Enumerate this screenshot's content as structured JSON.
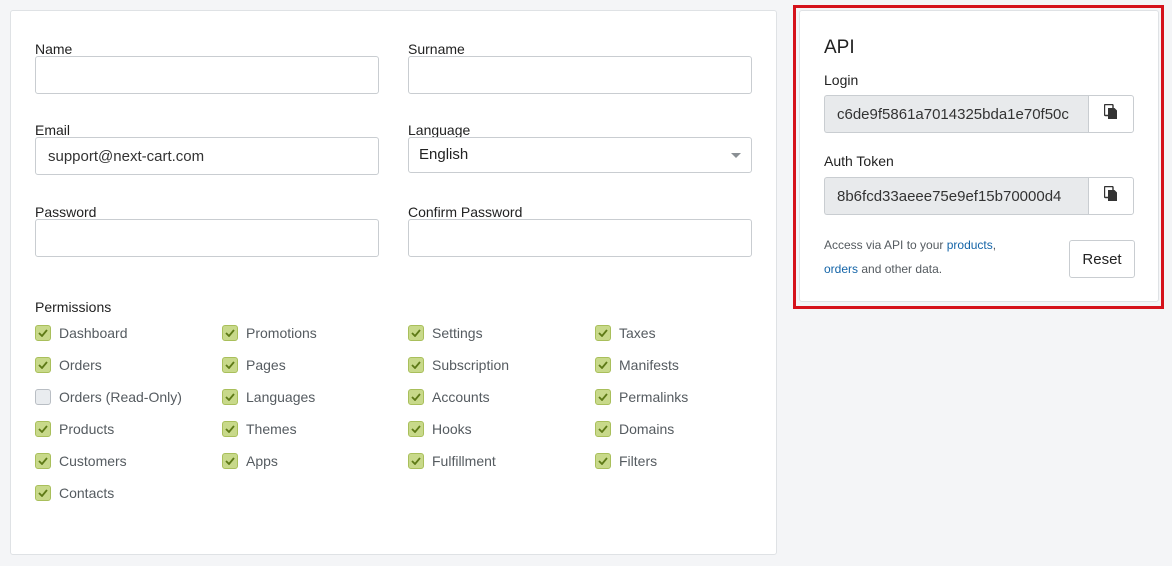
{
  "form": {
    "name_label": "Name",
    "name_value": "",
    "surname_label": "Surname",
    "surname_value": "",
    "email_label": "Email",
    "email_value": "support@next-cart.com",
    "language_label": "Language",
    "language_value": "English",
    "password_label": "Password",
    "password_value": "",
    "confirm_password_label": "Confirm Password",
    "confirm_password_value": ""
  },
  "permissions": {
    "heading": "Permissions",
    "items": [
      {
        "label": "Dashboard",
        "checked": true
      },
      {
        "label": "Orders",
        "checked": true
      },
      {
        "label": "Orders (Read-Only)",
        "checked": false
      },
      {
        "label": "Products",
        "checked": true
      },
      {
        "label": "Customers",
        "checked": true
      },
      {
        "label": "Contacts",
        "checked": true
      },
      {
        "label": "Promotions",
        "checked": true
      },
      {
        "label": "Pages",
        "checked": true
      },
      {
        "label": "Languages",
        "checked": true
      },
      {
        "label": "Themes",
        "checked": true
      },
      {
        "label": "Apps",
        "checked": true
      },
      {
        "label": "Settings",
        "checked": true
      },
      {
        "label": "Subscription",
        "checked": true
      },
      {
        "label": "Accounts",
        "checked": true
      },
      {
        "label": "Hooks",
        "checked": true
      },
      {
        "label": "Fulfillment",
        "checked": true
      },
      {
        "label": "Taxes",
        "checked": true
      },
      {
        "label": "Manifests",
        "checked": true
      },
      {
        "label": "Permalinks",
        "checked": true
      },
      {
        "label": "Domains",
        "checked": true
      },
      {
        "label": "Filters",
        "checked": true
      }
    ]
  },
  "api": {
    "title": "API",
    "login_label": "Login",
    "login_value": "c6de9f5861a7014325bda1e70f50c",
    "auth_token_label": "Auth Token",
    "auth_token_value": "8b6fcd33aeee75e9ef15b70000d4",
    "help_prefix": "Access via API to your ",
    "help_link_products": "products",
    "help_comma": ",",
    "help_link_orders": "orders",
    "help_suffix": " and other data.",
    "reset_label": "Reset",
    "copy_icon": "copy-icon"
  },
  "colors": {
    "checkbox_checked": "#c8d98a",
    "checkbox_check_mark": "#5e7a17",
    "link": "#1565a8",
    "highlight_border": "#d5121b"
  }
}
